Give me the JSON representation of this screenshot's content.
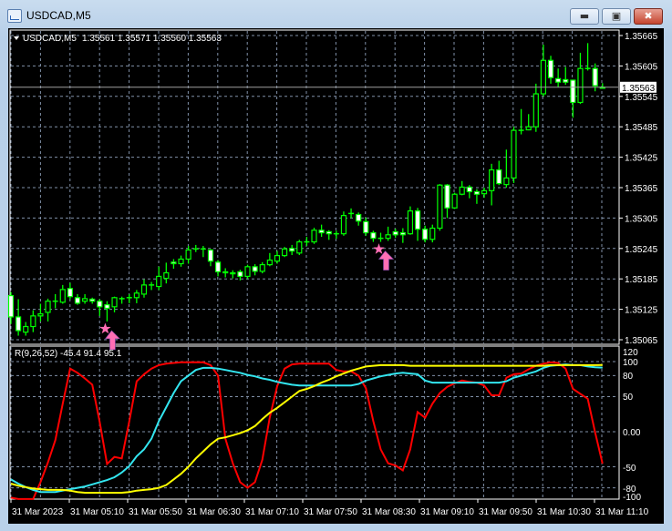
{
  "window": {
    "title": "USDCAD,M5",
    "buttons": {
      "minimize": "minimize",
      "maximize": "maximize",
      "close": "close"
    }
  },
  "chart": {
    "symbol_header": "USDCAD,M5",
    "ohlc_header": "1.35561 1.35571 1.35560 1.35563",
    "current_price_label": "1.35563",
    "current_price": 1.35563,
    "price_ticks": [
      "1.35665",
      "1.35605",
      "1.35545",
      "1.35485",
      "1.35425",
      "1.35365",
      "1.35305",
      "1.35245",
      "1.35185",
      "1.35125",
      "1.35065"
    ],
    "time_labels": [
      "31 Mar 2023",
      "31 Mar 05:10",
      "31 Mar 05:50",
      "31 Mar 06:30",
      "31 Mar 07:10",
      "31 Mar 07:50",
      "31 Mar 08:30",
      "31 Mar 09:10",
      "31 Mar 09:50",
      "31 Mar 10:30",
      "31 Mar 11:10"
    ],
    "colors": {
      "background": "#000000",
      "candle_outline": "#00ff00",
      "bear_fill": "#ffffff",
      "bull_fill": "#000000",
      "grid": "#8090a8",
      "price_line": "#a0a0a0",
      "signal": "#ff6eb4"
    },
    "signals": [
      {
        "type": "buy-arrow",
        "bar": 13
      },
      {
        "type": "buy-arrow",
        "bar": 50
      }
    ],
    "candles_ohlc": [
      [
        1.35152,
        1.35159,
        1.35096,
        1.3511
      ],
      [
        1.3511,
        1.35145,
        1.35073,
        1.35083
      ],
      [
        1.3508,
        1.351,
        1.35073,
        1.35091
      ],
      [
        1.35091,
        1.35123,
        1.3508,
        1.35112
      ],
      [
        1.35112,
        1.35136,
        1.35101,
        1.35116
      ],
      [
        1.35119,
        1.35146,
        1.35101,
        1.35141
      ],
      [
        1.35141,
        1.35155,
        1.35127,
        1.35141
      ],
      [
        1.35139,
        1.35173,
        1.35136,
        1.35164
      ],
      [
        1.35166,
        1.35177,
        1.35145,
        1.3515
      ],
      [
        1.35148,
        1.35155,
        1.35134,
        1.35137
      ],
      [
        1.35141,
        1.35155,
        1.35136,
        1.35146
      ],
      [
        1.35145,
        1.35148,
        1.35136,
        1.35141
      ],
      [
        1.35141,
        1.35145,
        1.35112,
        1.3513
      ],
      [
        1.35134,
        1.35141,
        1.35101,
        1.35127
      ],
      [
        1.3513,
        1.3515,
        1.35119,
        1.35148
      ],
      [
        1.35146,
        1.3515,
        1.35136,
        1.35146
      ],
      [
        1.35148,
        1.35155,
        1.35137,
        1.35148
      ],
      [
        1.35148,
        1.35163,
        1.35137,
        1.35157
      ],
      [
        1.35155,
        1.35184,
        1.35148,
        1.35173
      ],
      [
        1.35172,
        1.35179,
        1.35163,
        1.35173
      ],
      [
        1.3517,
        1.35209,
        1.35163,
        1.3519
      ],
      [
        1.35186,
        1.35217,
        1.35176,
        1.35197
      ],
      [
        1.35218,
        1.35224,
        1.35205,
        1.35215
      ],
      [
        1.35215,
        1.35231,
        1.35209,
        1.35224
      ],
      [
        1.35224,
        1.3525,
        1.35215,
        1.35242
      ],
      [
        1.35244,
        1.35252,
        1.35238,
        1.35244
      ],
      [
        1.35244,
        1.3525,
        1.35228,
        1.35244
      ],
      [
        1.35242,
        1.35244,
        1.3521,
        1.3522
      ],
      [
        1.35218,
        1.35222,
        1.3519,
        1.35199
      ],
      [
        1.35199,
        1.35206,
        1.35188,
        1.35197
      ],
      [
        1.35197,
        1.35202,
        1.35186,
        1.35195
      ],
      [
        1.35199,
        1.35203,
        1.35182,
        1.3519
      ],
      [
        1.3519,
        1.35213,
        1.35185,
        1.35209
      ],
      [
        1.35209,
        1.35214,
        1.35192,
        1.352
      ],
      [
        1.352,
        1.35218,
        1.35196,
        1.35213
      ],
      [
        1.35213,
        1.35236,
        1.3521,
        1.35222
      ],
      [
        1.3522,
        1.3524,
        1.35215,
        1.35231
      ],
      [
        1.35231,
        1.35248,
        1.35228,
        1.35244
      ],
      [
        1.35245,
        1.35252,
        1.35232,
        1.3524
      ],
      [
        1.35236,
        1.35262,
        1.35232,
        1.35258
      ],
      [
        1.35258,
        1.35268,
        1.3525,
        1.35258
      ],
      [
        1.35258,
        1.35286,
        1.35254,
        1.35281
      ],
      [
        1.35281,
        1.35292,
        1.35268,
        1.35276
      ],
      [
        1.35278,
        1.35281,
        1.35262,
        1.35274
      ],
      [
        1.35274,
        1.3528,
        1.35264,
        1.35274
      ],
      [
        1.35274,
        1.35318,
        1.3527,
        1.3531
      ],
      [
        1.35314,
        1.35324,
        1.35305,
        1.35314
      ],
      [
        1.35312,
        1.35316,
        1.3529,
        1.35299
      ],
      [
        1.35298,
        1.35306,
        1.3527,
        1.35276
      ],
      [
        1.35276,
        1.3528,
        1.35258,
        1.35265
      ],
      [
        1.35265,
        1.35276,
        1.35258,
        1.35265
      ],
      [
        1.35265,
        1.35288,
        1.3526,
        1.35272
      ],
      [
        1.35278,
        1.35284,
        1.35266,
        1.35272
      ],
      [
        1.35276,
        1.35285,
        1.35256,
        1.35272
      ],
      [
        1.35274,
        1.35328,
        1.35272,
        1.35319
      ],
      [
        1.35319,
        1.35325,
        1.3526,
        1.35283
      ],
      [
        1.35283,
        1.3529,
        1.35257,
        1.35263
      ],
      [
        1.35263,
        1.35292,
        1.35257,
        1.35285
      ],
      [
        1.35285,
        1.35372,
        1.3528,
        1.3537
      ],
      [
        1.3537,
        1.35372,
        1.35305,
        1.35325
      ],
      [
        1.35325,
        1.35355,
        1.35323,
        1.35352
      ],
      [
        1.35352,
        1.35378,
        1.3535,
        1.35366
      ],
      [
        1.35366,
        1.3537,
        1.35344,
        1.35357
      ],
      [
        1.35357,
        1.35362,
        1.35333,
        1.35352
      ],
      [
        1.35353,
        1.35365,
        1.35345,
        1.35359
      ],
      [
        1.35359,
        1.35412,
        1.3533,
        1.354
      ],
      [
        1.354,
        1.35418,
        1.3537,
        1.35373
      ],
      [
        1.35371,
        1.3544,
        1.35365,
        1.35384
      ],
      [
        1.35384,
        1.35485,
        1.35374,
        1.35478
      ],
      [
        1.35478,
        1.3552,
        1.3547,
        1.35478
      ],
      [
        1.35479,
        1.3551,
        1.35478,
        1.35485
      ],
      [
        1.35485,
        1.3557,
        1.35475,
        1.3555
      ],
      [
        1.3555,
        1.35647,
        1.35545,
        1.35616
      ],
      [
        1.35616,
        1.35625,
        1.3557,
        1.35582
      ],
      [
        1.3558,
        1.356,
        1.35563,
        1.35573
      ],
      [
        1.35578,
        1.35603,
        1.35568,
        1.35573
      ],
      [
        1.35577,
        1.35578,
        1.35503,
        1.35533
      ],
      [
        1.35533,
        1.35631,
        1.3553,
        1.356
      ],
      [
        1.356,
        1.3565,
        1.35596,
        1.356
      ],
      [
        1.356,
        1.3561,
        1.35555,
        1.35566
      ],
      [
        1.35561,
        1.35571,
        1.3556,
        1.35563
      ]
    ]
  },
  "indicator": {
    "header": "R(9,26,52) -45.4 91.4 95.1",
    "level_ticks": [
      "120",
      "100",
      "80",
      "50",
      "0.00",
      "-50",
      "-80",
      "-100"
    ],
    "range": [
      -100,
      120
    ],
    "grid_levels": [
      100,
      80,
      50,
      0,
      -50,
      -80
    ],
    "series": [
      {
        "color": "#ff0000",
        "values": [
          -94,
          -96,
          -96,
          -96,
          -72,
          -44,
          -12,
          40,
          90,
          84,
          76,
          67,
          14,
          -46,
          -36,
          -38,
          15,
          72,
          82,
          90,
          95,
          97,
          98,
          99,
          99,
          99,
          99,
          95,
          80,
          -10,
          -45,
          -72,
          -80,
          -72,
          -40,
          20,
          65,
          90,
          96,
          97,
          97,
          97,
          97,
          97,
          88,
          86,
          86,
          80,
          62,
          15,
          -25,
          -45,
          -48,
          -55,
          -25,
          28,
          20,
          40,
          55,
          64,
          69,
          73,
          71,
          70,
          66,
          52,
          52,
          77,
          82,
          83,
          89,
          94,
          97,
          99,
          98,
          90,
          61,
          54,
          47,
          -1,
          -45.4
        ]
      },
      {
        "color": "#33e6f0",
        "values": [
          -68,
          -74,
          -79,
          -83,
          -86,
          -86,
          -86,
          -84,
          -82,
          -80,
          -78,
          -75,
          -72,
          -69,
          -65,
          -58,
          -49,
          -35,
          -25,
          -10,
          15,
          35,
          55,
          72,
          80,
          88,
          91,
          91,
          90,
          88,
          86,
          84,
          81,
          79,
          76,
          74,
          71,
          69,
          67,
          66,
          66,
          66,
          66,
          66,
          66,
          66,
          66,
          68,
          73,
          76,
          79,
          81,
          83,
          84,
          83,
          82,
          73,
          70,
          70,
          70,
          70,
          70,
          70,
          70,
          70,
          70,
          70,
          72,
          77,
          80,
          83,
          86,
          91,
          94,
          95,
          96,
          95,
          95,
          93,
          92,
          91.4
        ]
      },
      {
        "color": "#ffff00",
        "values": [
          -74,
          -77,
          -79,
          -81,
          -82,
          -83,
          -83,
          -83,
          -84,
          -86,
          -87,
          -87,
          -87,
          -87,
          -87,
          -87,
          -86,
          -84,
          -83,
          -82,
          -80,
          -76,
          -68,
          -60,
          -50,
          -38,
          -28,
          -18,
          -10,
          -8,
          -5,
          -2,
          2,
          8,
          18,
          27,
          34,
          42,
          50,
          58,
          61,
          65,
          70,
          74,
          79,
          83,
          87,
          90,
          93,
          94,
          95,
          95,
          95,
          95,
          94,
          94,
          94,
          94,
          94,
          94,
          94,
          94,
          94,
          94,
          94,
          94,
          94,
          94,
          94,
          94,
          94,
          94,
          94,
          95,
          95,
          95,
          95,
          95,
          95,
          95,
          95.1
        ]
      }
    ]
  }
}
